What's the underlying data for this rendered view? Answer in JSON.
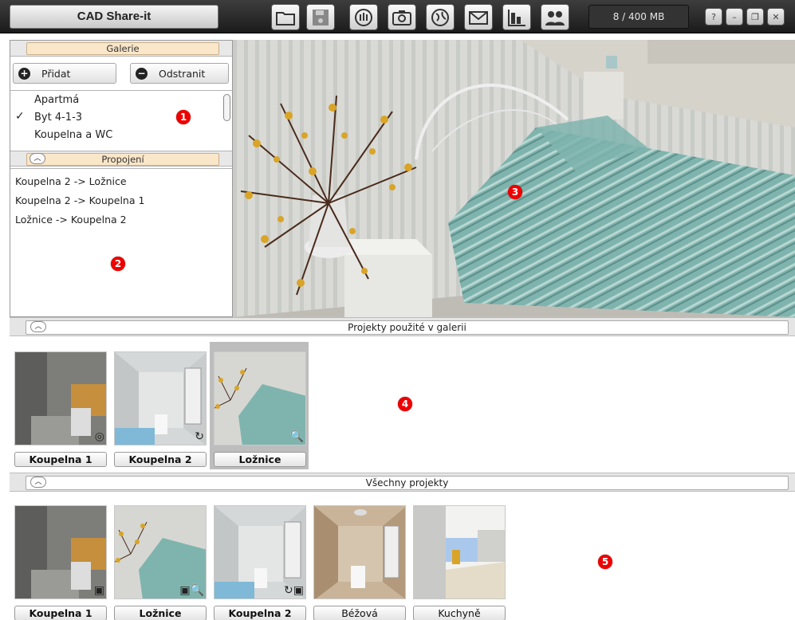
{
  "app": {
    "title": "CAD Share-it",
    "storage": "8 / 400 MB"
  },
  "toolbar": {
    "icons": [
      "folder-icon",
      "disk-icon",
      "globe-hand-icon",
      "camera-icon",
      "web-icon",
      "mail-icon",
      "chart-icon",
      "users-icon"
    ],
    "window_buttons": [
      "help-icon",
      "minimize-icon",
      "restore-icon",
      "close-icon"
    ]
  },
  "gallery": {
    "header": "Galerie",
    "add_label": "Přidat",
    "remove_label": "Odstranit",
    "items": [
      {
        "label": "Apartmá",
        "checked": false
      },
      {
        "label": "Byt 4-1-3",
        "checked": true
      },
      {
        "label": "Koupelna a WC",
        "checked": false
      }
    ],
    "check_glyph": "✓"
  },
  "links": {
    "header": "Propojení",
    "items": [
      "Koupelna 2 -> Ložnice",
      "Koupelna 2 -> Koupelna 1",
      "Ložnice -> Koupelna 2"
    ]
  },
  "used_projects": {
    "header": "Projekty použité v galerii",
    "items": [
      {
        "label": "Koupelna 1",
        "badge": "◎"
      },
      {
        "label": "Koupelna 2",
        "badge": "↻"
      },
      {
        "label": "Ložnice",
        "badge": "🔍"
      }
    ]
  },
  "all_projects": {
    "header": "Všechny projekty",
    "items": [
      {
        "label": "Koupelna 1",
        "badge": "▣"
      },
      {
        "label": "Ložnice",
        "badge": "▣🔍"
      },
      {
        "label": "Koupelna 2",
        "badge": "↻▣"
      },
      {
        "label": "Béžová",
        "badge": ""
      },
      {
        "label": "Kuchyně",
        "badge": ""
      }
    ]
  },
  "markers": [
    "1",
    "2",
    "3",
    "4",
    "5"
  ],
  "colors": {
    "marker": "#e00000",
    "tab_header": "#fae6c8",
    "titlebar": "#2a2a2a"
  }
}
